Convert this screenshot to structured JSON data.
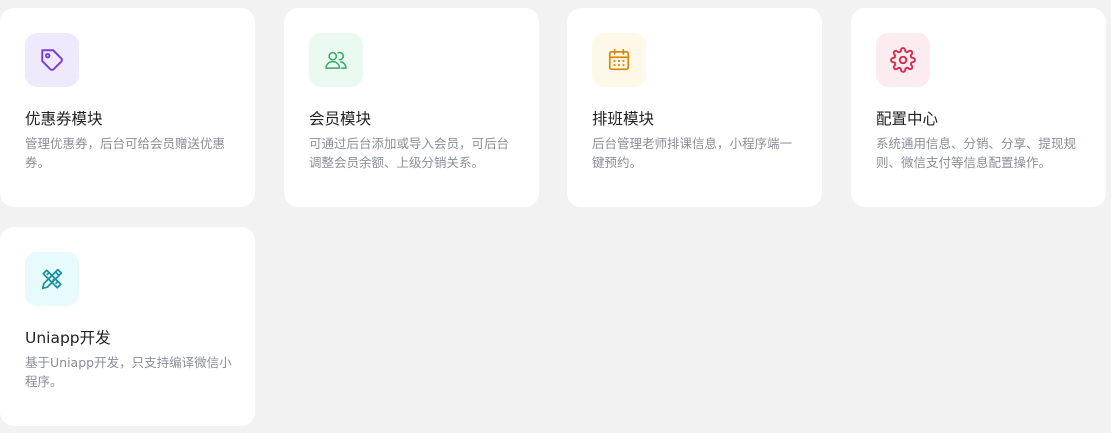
{
  "modules": [
    {
      "title": "优惠券模块",
      "desc": "管理优惠券，后台可给会员赠送优惠券。",
      "icon": "tag-icon",
      "icon_bg": "#efe9fd",
      "icon_color": "#7a3fd6"
    },
    {
      "title": "会员模块",
      "desc": "可通过后台添加或导入会员，可后台调整会员余额、上级分销关系。",
      "icon": "users-icon",
      "icon_bg": "#eafaf1",
      "icon_color": "#3aa66a"
    },
    {
      "title": "排班模块",
      "desc": "后台管理老师排课信息，小程序端一键预约。",
      "icon": "calendar-icon",
      "icon_bg": "#fdf8e7",
      "icon_color": "#d98a12"
    },
    {
      "title": "配置中心",
      "desc": "系统通用信息、分销、分享、提现规则、微信支付等信息配置操作。",
      "icon": "gear-icon",
      "icon_bg": "#fdecef",
      "icon_color": "#d8264a"
    },
    {
      "title": "Uniapp开发",
      "desc": "基于Uniapp开发，只支持编译微信小程序。",
      "icon": "pencil-ruler-icon",
      "icon_bg": "#e7fbfd",
      "icon_color": "#1c8fa0"
    }
  ]
}
